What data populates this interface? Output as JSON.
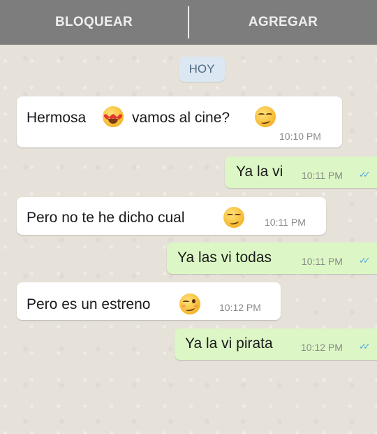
{
  "topbar": {
    "block_label": "BLOQUEAR",
    "add_label": "AGREGAR"
  },
  "date_chip": "HOY",
  "messages": [
    {
      "direction": "in",
      "text_before": "Hermosa",
      "emoji_1": "heart-eyes-emoji",
      "text_after": "vamos al cine?",
      "emoji_2": "smirk-emoji",
      "time": "10:10 PM"
    },
    {
      "direction": "out",
      "text": "Ya la vi",
      "time": "10:11 PM",
      "status": "read"
    },
    {
      "direction": "in",
      "text": "Pero no te he dicho cual",
      "emoji": "smirk-emoji",
      "time": "10:11 PM"
    },
    {
      "direction": "out",
      "text": "Ya las vi todas",
      "time": "10:11 PM",
      "status": "read"
    },
    {
      "direction": "in",
      "text": "Pero es un estreno",
      "emoji": "wink-emoji",
      "time": "10:12 PM"
    },
    {
      "direction": "out",
      "text": "Ya la vi pirata",
      "time": "10:12 PM",
      "status": "read"
    }
  ],
  "colors": {
    "topbar": "#7d7d7d",
    "incoming_bubble": "#ffffff",
    "outgoing_bubble": "#dcf7c5",
    "read_ticks": "#4fa6e0",
    "date_chip": "#dbe8f3"
  }
}
